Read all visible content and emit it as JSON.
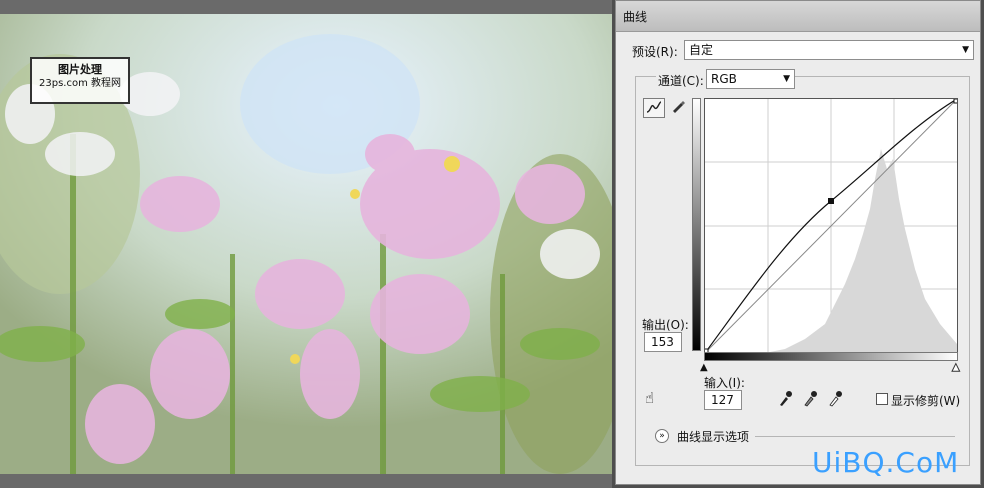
{
  "photo": {
    "watermark_line1": "图片处理",
    "watermark_line2": "23ps.com 教程网"
  },
  "dialog": {
    "title": "曲线",
    "preset_label": "预设(R):",
    "preset_value": "自定",
    "channel_label": "通道(C):",
    "channel_value": "RGB",
    "output_label": "输出(O):",
    "output_value": "153",
    "input_label": "输入(I):",
    "input_value": "127",
    "show_clipping_label": "显示修剪(W)",
    "curve_options_label": "曲线显示选项",
    "curve_point": {
      "input": 127,
      "output": 153
    }
  },
  "brand": "UiBQ.CoM",
  "icons": {
    "curve_tool": "curve-icon",
    "pencil_tool": "pencil-icon",
    "hand_tool": "hand-adjust-icon",
    "black_eyedropper": "eyedropper-black-icon",
    "gray_eyedropper": "eyedropper-gray-icon",
    "white_eyedropper": "eyedropper-white-icon",
    "expand": "chevron-double-down-icon"
  }
}
